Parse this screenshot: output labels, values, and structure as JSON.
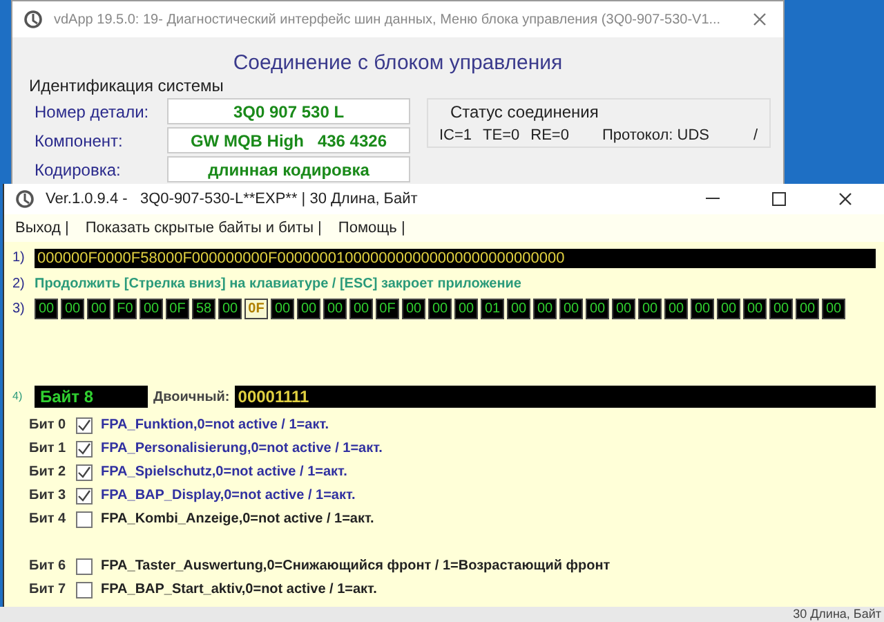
{
  "back_window": {
    "title": "vdApp 19.5.0: 19- Диагностический интерфейс шин данных,  Меню блока управления (3Q0-907-530-V1...",
    "heading": "Соединение с блоком управления",
    "identification": {
      "title": "Идентификация системы",
      "fields": [
        {
          "label": "Номер детали:",
          "value": "3Q0 907 530 L"
        },
        {
          "label": "Компонент:",
          "value": "GW MQB High   436 4326"
        },
        {
          "label": "Кодировка:",
          "value": "длинная кодировка"
        }
      ]
    },
    "status": {
      "title": "Статус соединения",
      "ic": "IC=1",
      "te": "TE=0",
      "re": "RE=0",
      "protocol": "Протокол: UDS",
      "spinner": "/"
    }
  },
  "front_window": {
    "title": "Ver.1.0.9.4 -   3Q0-907-530-L**EXP** | 30 Длина, Байт",
    "menu": [
      "Выход |",
      "Показать скрытые байты и биты |",
      "Помощь |"
    ],
    "row1": {
      "label": "1)",
      "value": "000000F0000F58000F000000000F0000000100000000000000000000000000"
    },
    "row2": {
      "label": "2)",
      "text": "Продолжить [Стрелка вниз] на клавиатуре / [ESC] закроет приложение"
    },
    "row3": {
      "label": "3)",
      "bytes": [
        {
          "value": "00",
          "selected": false
        },
        {
          "value": "00",
          "selected": false
        },
        {
          "value": "00",
          "selected": false
        },
        {
          "value": "F0",
          "selected": false
        },
        {
          "value": "00",
          "selected": false
        },
        {
          "value": "0F",
          "selected": false
        },
        {
          "value": "58",
          "selected": false
        },
        {
          "value": "00",
          "selected": false
        },
        {
          "value": "0F",
          "selected": true
        },
        {
          "value": "00",
          "selected": false
        },
        {
          "value": "00",
          "selected": false
        },
        {
          "value": "00",
          "selected": false
        },
        {
          "value": "00",
          "selected": false
        },
        {
          "value": "0F",
          "selected": false
        },
        {
          "value": "00",
          "selected": false
        },
        {
          "value": "00",
          "selected": false
        },
        {
          "value": "00",
          "selected": false
        },
        {
          "value": "01",
          "selected": false
        },
        {
          "value": "00",
          "selected": false
        },
        {
          "value": "00",
          "selected": false
        },
        {
          "value": "00",
          "selected": false
        },
        {
          "value": "00",
          "selected": false
        },
        {
          "value": "00",
          "selected": false
        },
        {
          "value": "00",
          "selected": false
        },
        {
          "value": "00",
          "selected": false
        },
        {
          "value": "00",
          "selected": false
        },
        {
          "value": "00",
          "selected": false
        },
        {
          "value": "00",
          "selected": false
        },
        {
          "value": "00",
          "selected": false
        },
        {
          "value": "00",
          "selected": false
        },
        {
          "value": "00",
          "selected": false
        }
      ]
    },
    "row4": {
      "label": "4)",
      "byte": "Байт 8",
      "binary_label": "Двоичный:",
      "binary": "00001111"
    },
    "bits": [
      {
        "label": "Бит 0",
        "checked": true,
        "text": "FPA_Funktion,0=not active / 1=акт.",
        "spaced": false
      },
      {
        "label": "Бит 1",
        "checked": true,
        "text": "FPA_Personalisierung,0=not active / 1=акт.",
        "spaced": false
      },
      {
        "label": "Бит 2",
        "checked": true,
        "text": "FPA_Spielschutz,0=not active / 1=акт.",
        "spaced": false
      },
      {
        "label": "Бит 3",
        "checked": true,
        "text": "FPA_BAP_Display,0=not active / 1=акт.",
        "spaced": false
      },
      {
        "label": "Бит 4",
        "checked": false,
        "text": "FPA_Kombi_Anzeige,0=not active / 1=акт.",
        "spaced": false
      },
      {
        "label": "Бит 6",
        "checked": false,
        "text": "FPA_Taster_Auswertung,0=Снижающийся фронт / 1=Возрастающий фронт",
        "spaced": true
      },
      {
        "label": "Бит 7",
        "checked": false,
        "text": "FPA_BAP_Start_aktiv,0=not active / 1=акт.",
        "spaced": false
      }
    ],
    "status_bar": "30 Длина, Байт"
  }
}
